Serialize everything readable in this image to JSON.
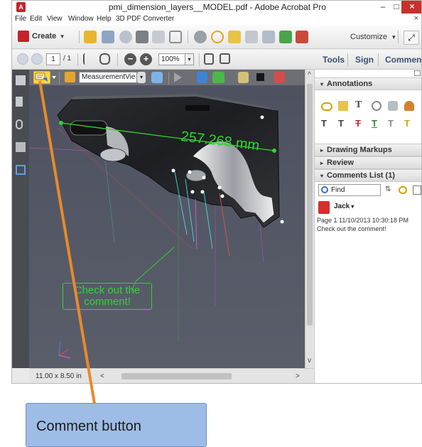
{
  "window": {
    "title": "pmi_dimension_layers__MODEL.pdf - Adobe Acrobat Pro",
    "app_icon_glyph": "A",
    "minimize_glyph": "–",
    "maximize_glyph": "□",
    "close_glyph": "×"
  },
  "menu": {
    "items": [
      "File",
      "Edit",
      "View",
      "Window",
      "Help",
      "3D PDF Converter"
    ],
    "close_glyph": "×"
  },
  "toolbar": {
    "create_label": "Create",
    "create_arrow": "▾",
    "customize_label": "Customize",
    "customize_arrow": "▾",
    "expand_glyph": "⤢"
  },
  "navbar": {
    "current_page": "1",
    "total_pages": "/ 1",
    "zoom_out_glyph": "−",
    "zoom_in_glyph": "+",
    "zoom_level": "100%",
    "zoom_arrow": "▾",
    "tools_label": "Tools",
    "sign_label": "Sign",
    "comment_label": "Comment"
  },
  "toolbar3d": {
    "view_select": "MeasurementVie",
    "view_arrow": "▾"
  },
  "canvas": {
    "measurement": "257.268 mm",
    "comment_note_line1": "Check out the",
    "comment_note_line2": "comment!"
  },
  "status": {
    "page_size": "11.00 x 8.50 in",
    "scroll_left": "<",
    "scroll_right": ">",
    "scroll_up": "^",
    "scroll_down": "v"
  },
  "panel": {
    "annotations": "Annotations",
    "drawing_markups": "Drawing Markups",
    "review": "Review",
    "comments_list": "Comments List (1)",
    "find_placeholder": "Find",
    "expanded_arrow": "▾",
    "collapsed_arrow": "▸"
  },
  "comment": {
    "author": "Jack",
    "author_arrow": "▾",
    "meta": "Page 1  11/10/2013 10:30:18 PM",
    "text": "Check out the comment!"
  },
  "callout": {
    "label": "Comment button"
  },
  "colors": {
    "accent_green": "#31d431",
    "highlight_yellow": "#ffd64a",
    "callout_blue": "#9dbde6",
    "callout_line": "#e78a2c",
    "adobe_red": "#c4232b"
  }
}
